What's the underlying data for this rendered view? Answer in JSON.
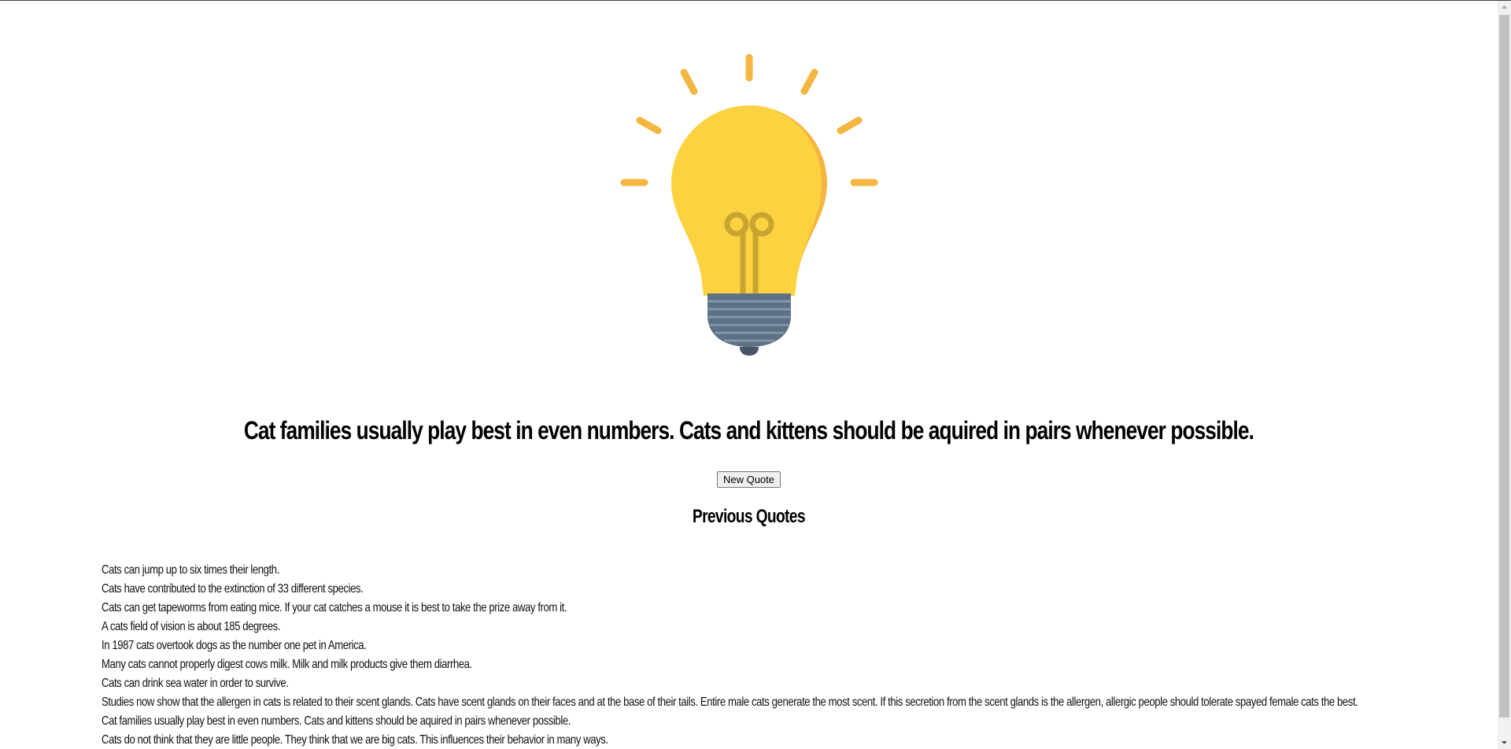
{
  "quote": {
    "text": "Cat families usually play best in even numbers. Cats and kittens should be aquired in pairs whenever possible."
  },
  "button": {
    "label": "New Quote"
  },
  "previous": {
    "heading": "Previous Quotes",
    "items": [
      "Cats can jump up to six times their length.",
      "Cats have contributed to the extinction of 33 different species.",
      "Cats can get tapeworms from eating mice. If your cat catches a mouse it is best to take the prize away from it.",
      "A cats field of vision is about 185 degrees.",
      "In 1987 cats overtook dogs as the number one pet in America.",
      "Many cats cannot properly digest cows milk. Milk and milk products give them diarrhea.",
      "Cats can drink sea water in order to survive.",
      "Studies now show that the allergen in cats is related to their scent glands. Cats have scent glands on their faces and at the base of their tails. Entire male cats generate the most scent. If this secretion from the scent glands is the allergen, allergic people should tolerate spayed female cats the best.",
      "Cat families usually play best in even numbers. Cats and kittens should be aquired in pairs whenever possible.",
      "Cats do not think that they are little people. They think that we are big cats. This influences their behavior in many ways."
    ]
  },
  "icons": {
    "illustration": "lightbulb-icon"
  },
  "colors": {
    "bulb": "#FCD240",
    "bulb_shade": "#F4B640",
    "rays": "#F4B640",
    "filament": "#C9A431",
    "base": "#5D7085",
    "base_stripe": "#8496A8",
    "tip": "#475566"
  }
}
